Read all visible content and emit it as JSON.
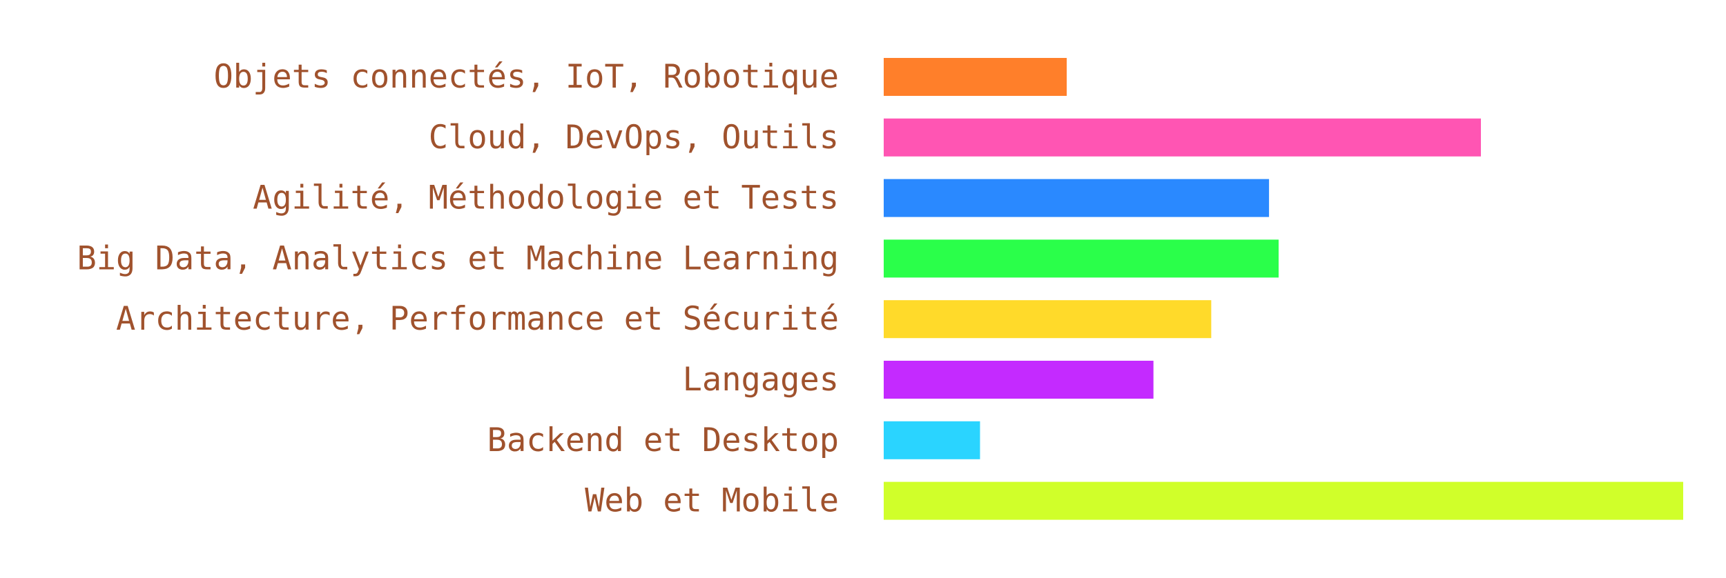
{
  "chart_data": {
    "type": "bar",
    "orientation": "horizontal",
    "title": "",
    "xlabel": "",
    "ylabel": "",
    "grid": false,
    "axes_visible": false,
    "legend": "none",
    "xlim": [
      0,
      83
    ],
    "label_color": "#A0522D",
    "categories": [
      "Objets connectés, IoT, Robotique",
      "Cloud, DevOps, Outils",
      "Agilité, Méthodologie et Tests",
      "Big Data, Analytics et Machine Learning",
      "Architecture, Performance et Sécurité",
      "Langages",
      "Backend et Desktop",
      "Web et Mobile"
    ],
    "values": [
      19,
      62,
      40,
      41,
      34,
      28,
      10,
      83
    ],
    "colors": [
      "#FF7F2A",
      "#FF55B3",
      "#2A89FF",
      "#2AFF4A",
      "#FFDA2A",
      "#C42AFF",
      "#2AD4FF",
      "#D0FF2A"
    ],
    "values_note": "relative values estimated from bar lengths (no axis shown)"
  }
}
